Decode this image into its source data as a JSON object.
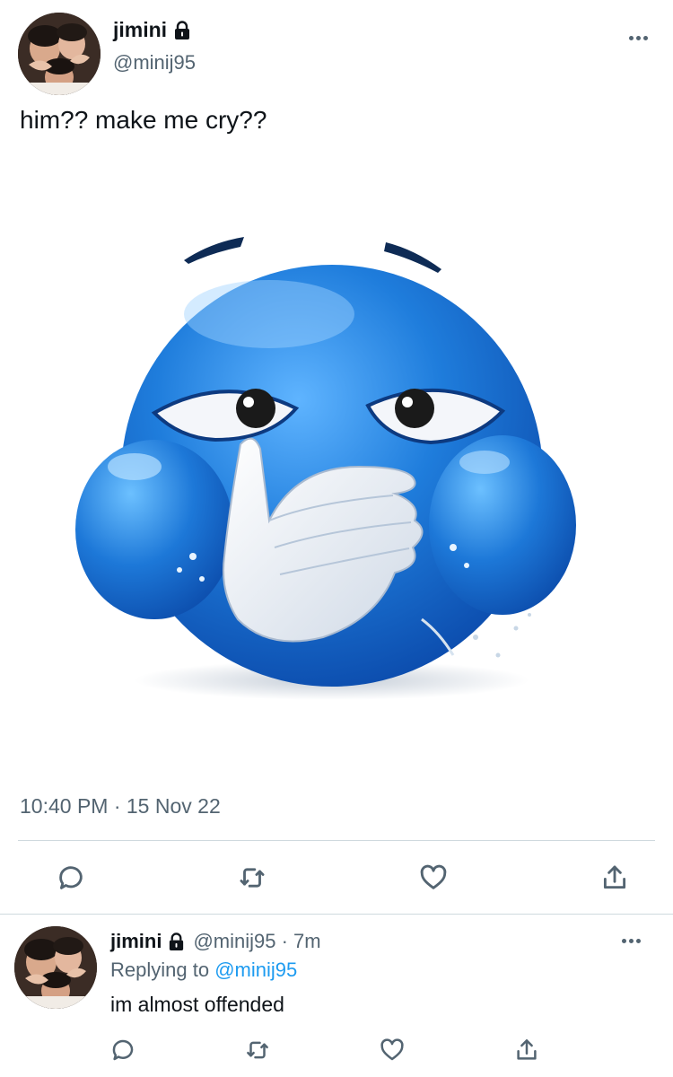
{
  "tweet": {
    "display_name": "jimini",
    "handle": "@minij95",
    "text": "him?? make me cry??",
    "media_description": "",
    "timestamp": "10:40 PM · 15 Nov 22",
    "actions": [
      "reply-icon",
      "retweet-icon",
      "like-icon",
      "share-icon"
    ]
  },
  "reply": {
    "display_name": "jimini",
    "handle_time": "@minij95 · 7m",
    "replying_prefix": "Replying to ",
    "replying_handle": "@minij95",
    "text": "im almost offended",
    "actions": [
      "reply-icon",
      "retweet-icon",
      "like-icon",
      "share-icon"
    ]
  },
  "colors": {
    "text": "#0f1419",
    "secondary": "#536471",
    "link": "#1d9bf0",
    "emoji_blue": "#1e78d6"
  }
}
